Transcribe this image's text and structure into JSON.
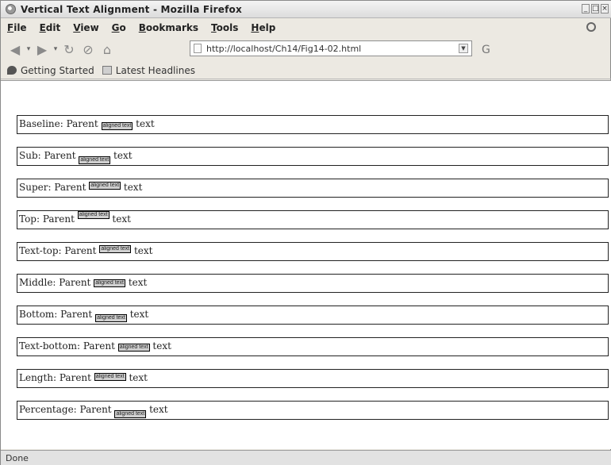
{
  "window": {
    "title": "Vertical Text Alignment - Mozilla Firefox"
  },
  "menu": [
    "File",
    "Edit",
    "View",
    "Go",
    "Bookmarks",
    "Tools",
    "Help"
  ],
  "nav": {
    "url": "http://localhost/Ch14/Fig14-02.html"
  },
  "bookmarks": [
    "Getting Started",
    "Latest Headlines"
  ],
  "rows": [
    {
      "label": "Baseline: Parent",
      "aligned": "aligned text",
      "after": "text"
    },
    {
      "label": "Sub: Parent",
      "aligned": "aligned text",
      "after": "text"
    },
    {
      "label": "Super: Parent",
      "aligned": "aligned text",
      "after": "text"
    },
    {
      "label": "Top: Parent",
      "aligned": "aligned text",
      "after": "text"
    },
    {
      "label": "Text-top: Parent",
      "aligned": "aligned text",
      "after": "text"
    },
    {
      "label": "Middle: Parent",
      "aligned": "aligned text",
      "after": "text"
    },
    {
      "label": "Bottom: Parent",
      "aligned": "aligned text",
      "after": "text"
    },
    {
      "label": "Text-bottom: Parent",
      "aligned": "aligned text",
      "after": "text"
    },
    {
      "label": "Length: Parent",
      "aligned": "aligned text",
      "after": "text"
    },
    {
      "label": "Percentage: Parent",
      "aligned": "aligned text",
      "after": "text"
    }
  ],
  "status": "Done"
}
